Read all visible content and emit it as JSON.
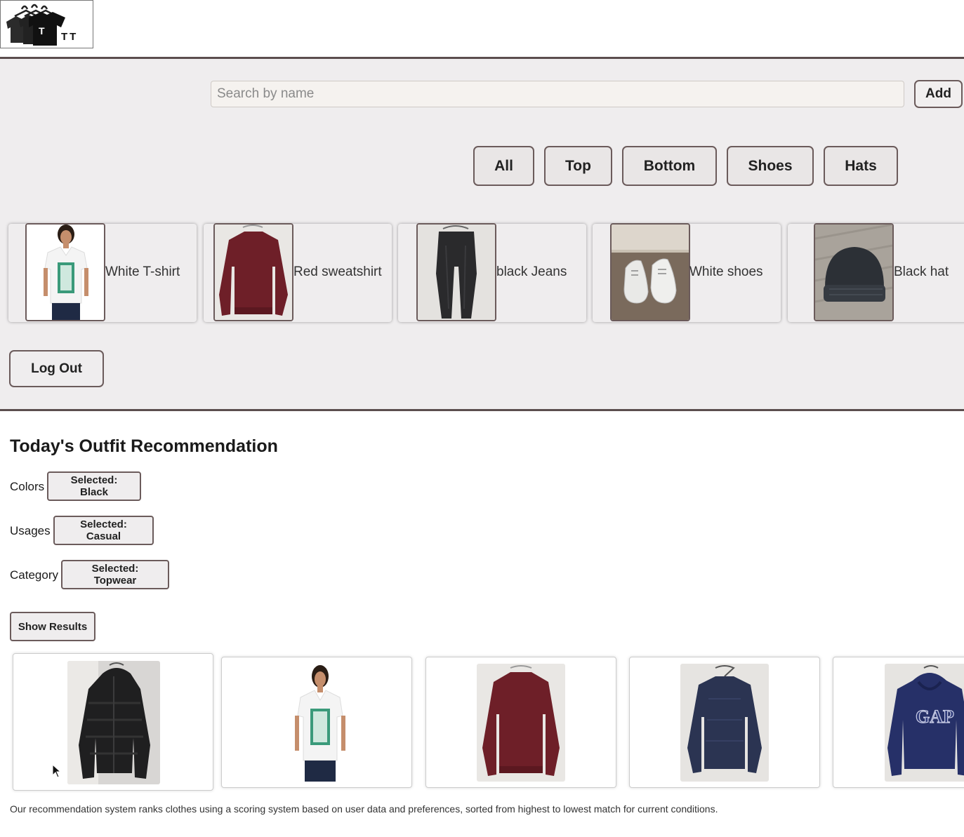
{
  "logo": {
    "text": "TT",
    "shirt_letter": "T"
  },
  "search": {
    "placeholder": "Search by name",
    "add_label": "Add"
  },
  "filters": [
    "All",
    "Top",
    "Bottom",
    "Shoes",
    "Hats"
  ],
  "items": [
    {
      "label": "White T-shirt"
    },
    {
      "label": "Red sweatshirt"
    },
    {
      "label": "black Jeans"
    },
    {
      "label": "White shoes"
    },
    {
      "label": "Black hat"
    }
  ],
  "logout_label": "Log Out",
  "recommendation": {
    "title": "Today's Outfit Recommendation",
    "colors_label": "Colors",
    "colors_value": "Selected: Black",
    "usages_label": "Usages",
    "usages_value": "Selected: Casual",
    "category_label": "Category",
    "category_value": "Selected: Topwear",
    "show_results_label": "Show Results",
    "gap_logo_text": "GAP",
    "footnote": "Our recommendation system ranks clothes using a scoring system based on user data and preferences, sorted from highest to lowest match for current conditions."
  }
}
